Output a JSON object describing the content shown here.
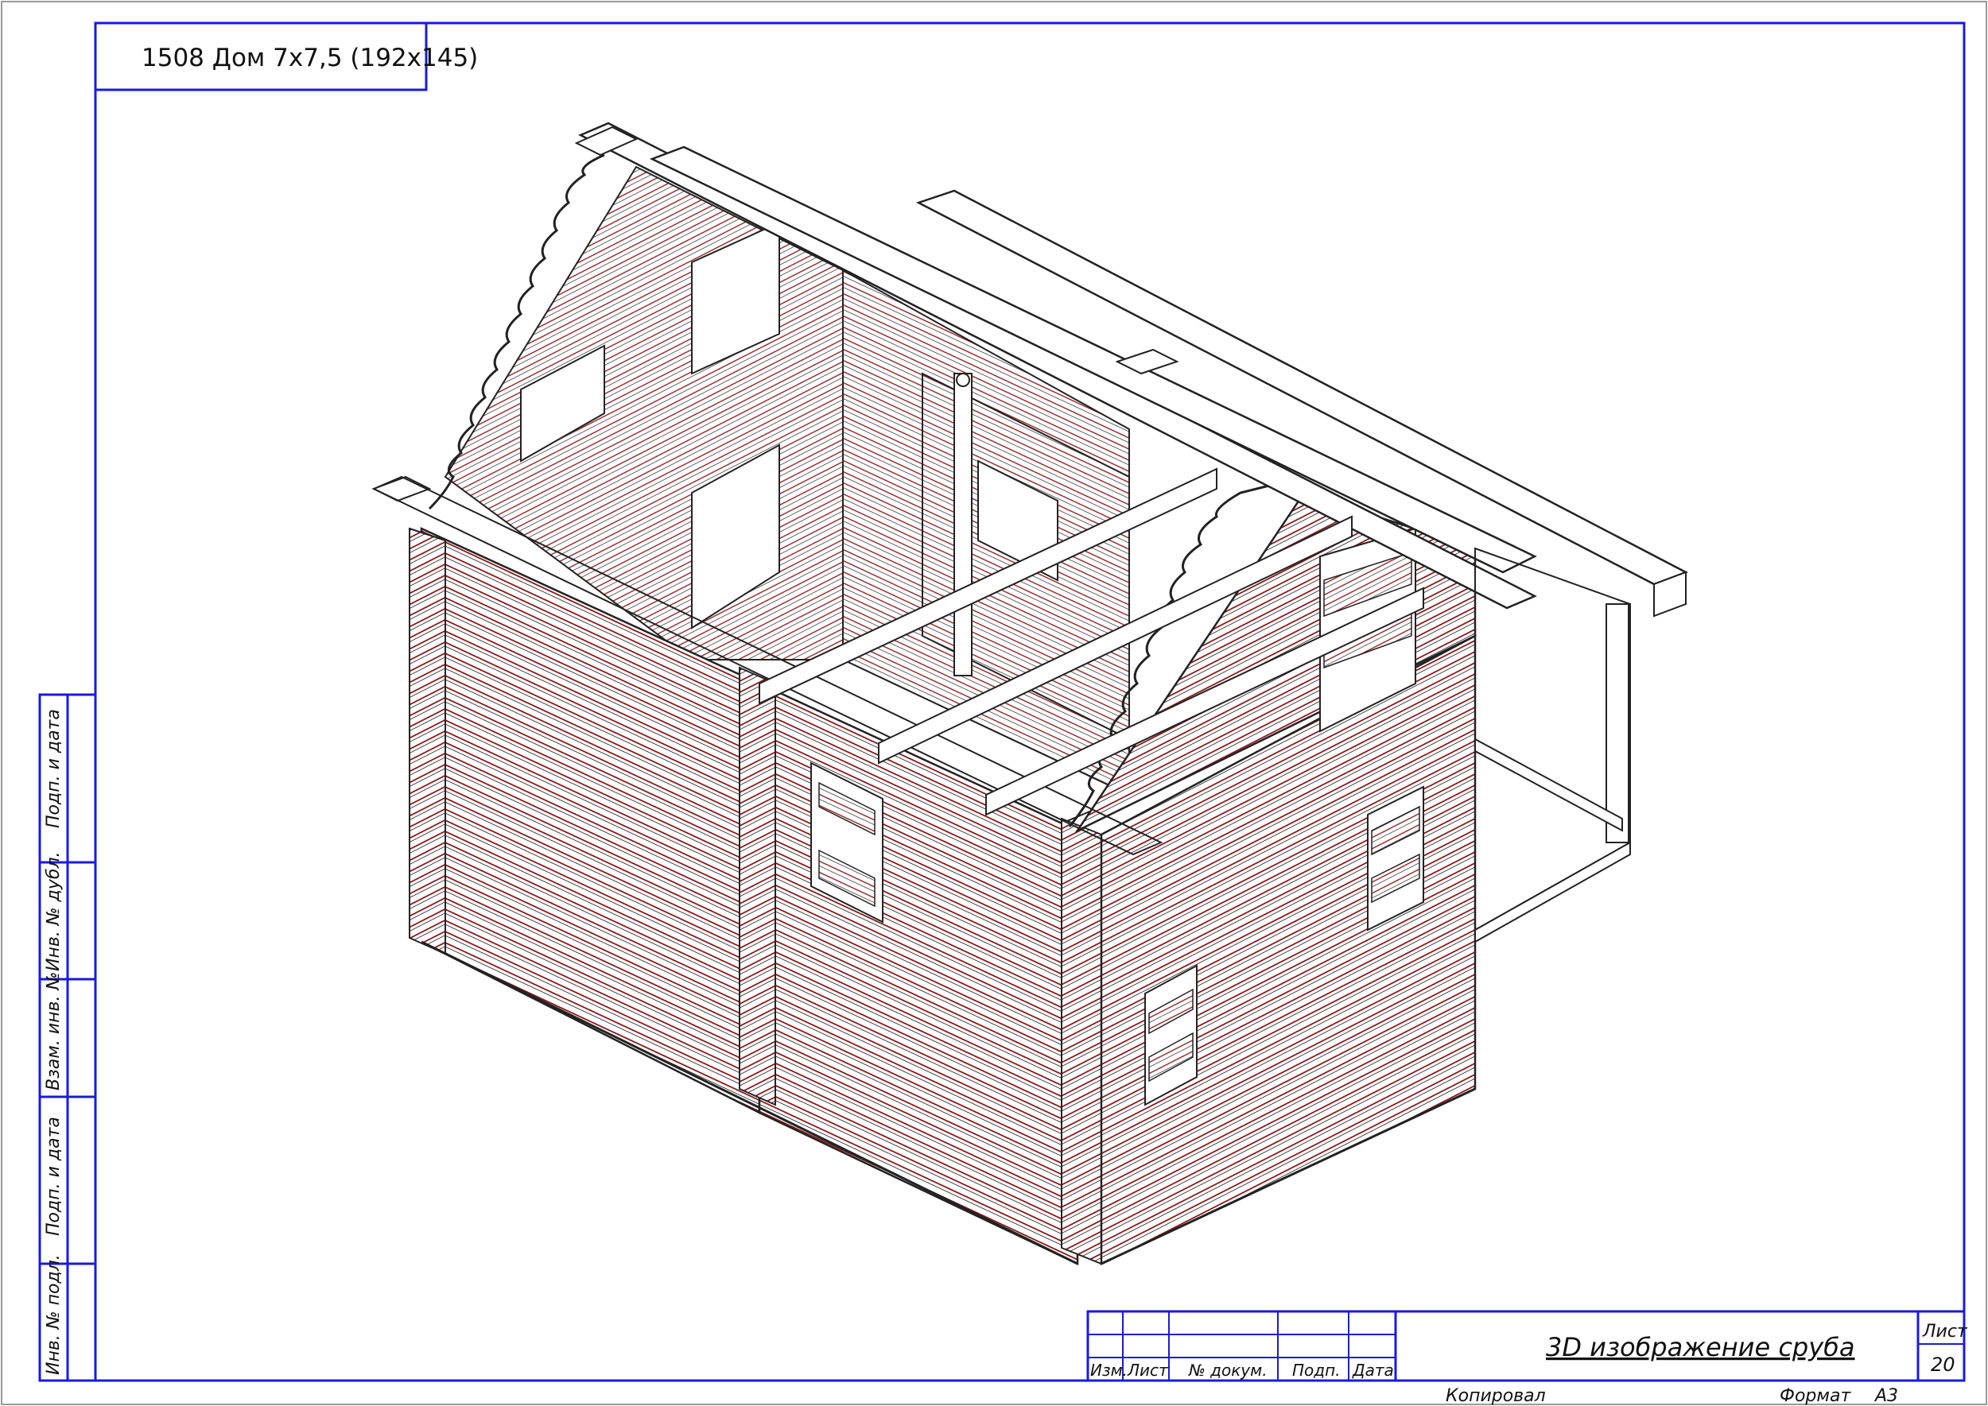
{
  "sheet": {
    "project_label": "1508 Дом 7х7,5 (192х145)",
    "frame_color": "#1a1adb",
    "log_line_color": "#8b1a1a",
    "outline_color": "#222222"
  },
  "side_stamp": {
    "cells": [
      "Подп. и дата",
      "Инв. № дубл.",
      "Взам. инв. №",
      "Подп. и дата",
      "Инв. № подл."
    ]
  },
  "title_block": {
    "headers": [
      "Изм.",
      "Лист",
      "№ докум.",
      "Подп.",
      "Дата"
    ],
    "title": "3D изображение сруба",
    "sheet_label": "Лист",
    "sheet_number": "20",
    "copied_label": "Копировал",
    "format_label": "Формат",
    "format_value": "А3"
  },
  "drawing": {
    "content": "isometric log house frame"
  }
}
